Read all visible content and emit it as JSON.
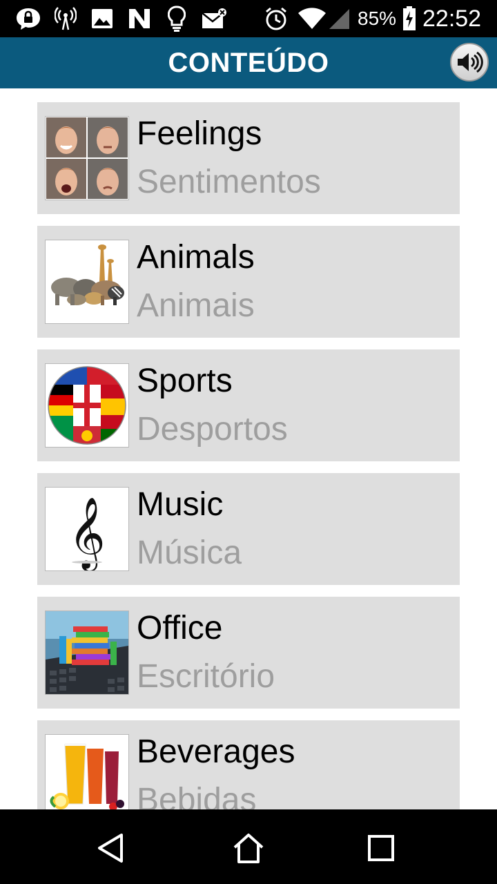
{
  "status_bar": {
    "battery_percent": "85%",
    "time": "22:52",
    "icons": [
      "lock-chat-icon",
      "signal-tower-icon",
      "image-icon",
      "n-icon",
      "lightbulb-icon",
      "mail-muted-icon",
      "alarm-icon",
      "wifi-icon",
      "cellular-icon",
      "battery-charging-icon"
    ]
  },
  "app_bar": {
    "title": "CONTEÚDO",
    "speaker_icon": "speaker-icon"
  },
  "categories": [
    {
      "en": "Feelings",
      "pt": "Sentimentos",
      "thumb": "faces-image"
    },
    {
      "en": "Animals",
      "pt": "Animais",
      "thumb": "animals-image"
    },
    {
      "en": "Sports",
      "pt": "Desportos",
      "thumb": "flags-ball-image"
    },
    {
      "en": "Music",
      "pt": "Música",
      "thumb": "treble-clef-image"
    },
    {
      "en": "Office",
      "pt": "Escritório",
      "thumb": "binders-laptop-image"
    },
    {
      "en": "Beverages",
      "pt": "Bebidas",
      "thumb": "juice-glasses-image"
    }
  ],
  "nav_bar": {
    "icons": [
      "back-icon",
      "home-icon",
      "recents-icon"
    ]
  }
}
